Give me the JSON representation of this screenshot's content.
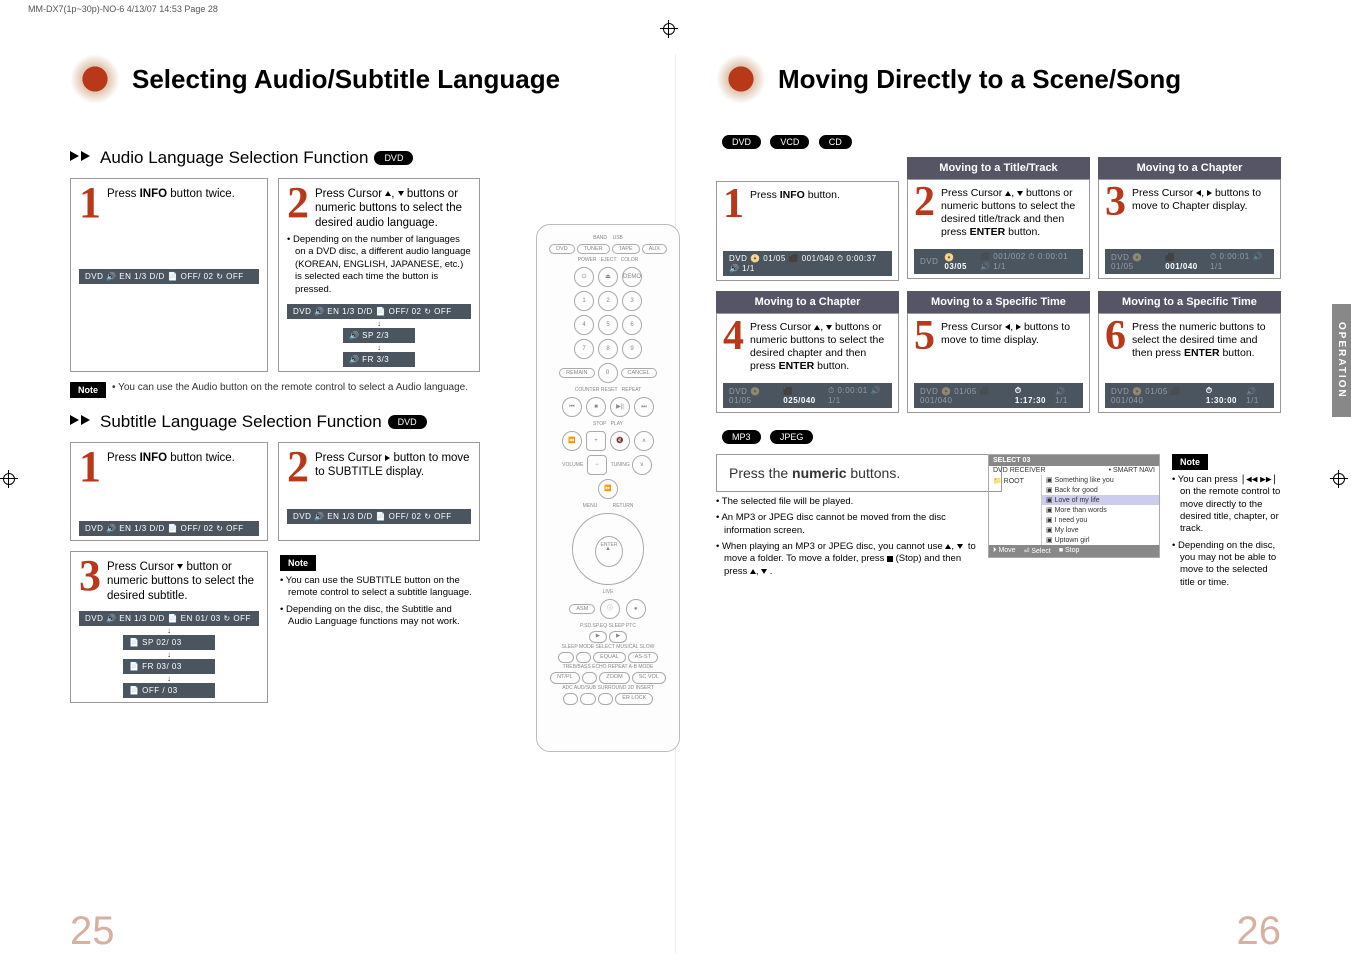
{
  "meta": {
    "header": "MM-DX7(1p~30p)-NO-6  4/13/07  14:53  Page 28"
  },
  "left": {
    "pageNumber": "25",
    "title": "Selecting Audio/Subtitle Language",
    "sectionA": {
      "heading": "Audio Language Selection Function",
      "badge": "DVD",
      "step1": "Press INFO button twice.",
      "step2": "Press Cursor ▲, ▼ buttons or numeric buttons to select the desired audio language.",
      "step2Bullet": "Depending on the number of languages on a DVD disc, a different audio language (KOREAN, ENGLISH, JAPANESE, etc.) is selected each time the button is pressed.",
      "osd1": "DVD  🔊 EN 1/3  D/D  📄 OFF/ 02  ↻ OFF",
      "osd2a": "DVD  🔊 EN 1/3  D/D  📄 OFF/ 02  ↻ OFF",
      "osd2b": "🔊 SP 2/3",
      "osd2c": "🔊 FR 3/3",
      "noteLabel": "Note",
      "note": "You can use the Audio button on the remote control to select a Audio language."
    },
    "sectionB": {
      "heading": "Subtitle Language Selection Function",
      "badge": "DVD",
      "step1": "Press INFO button twice.",
      "step2": "Press Cursor ▶ button to move to SUBTITLE display.",
      "step3": "Press Cursor ▼ button or numeric buttons to select the desired subtitle.",
      "osdA": "DVD  🔊 EN 1/3  D/D  📄 OFF/ 02  ↻ OFF",
      "osdB": "DVD  🔊 EN 1/3  D/D  📄 OFF/ 02  ↻ OFF",
      "osdCrow": "DVD  🔊 EN 1/3  D/D  📄 EN 01/ 03  ↻ OFF",
      "osdC1": "📄 SP 02/ 03",
      "osdC2": "📄 FR 03/ 03",
      "osdC3": "📄 OFF / 03",
      "noteLabel": "Note",
      "note1": "You can use the SUBTITLE button on the remote control to select a subtitle language.",
      "note2": "Depending on the disc, the Subtitle and Audio Language functions may not work."
    },
    "remote": {
      "band": "BAND",
      "usb": "USB",
      "dvd": "DVD",
      "tuner": "TUNER",
      "tape": "TAPE",
      "aux": "AUX",
      "power": "POWER",
      "eject": "EJECT",
      "color": "COLOR",
      "demo": "DEMO",
      "n": [
        "1",
        "2",
        "3",
        "4",
        "5",
        "6",
        "7",
        "8",
        "9",
        "0"
      ],
      "remain": "REMAIN",
      "cancel": "CANCEL",
      "counterreset": "COUNTER RESET",
      "repeat": "REPEAT",
      "stop": "STOP",
      "play": "PLAY",
      "volume": "VOLUME",
      "mute": "MUTE",
      "tuning": "TUNING",
      "menu": "MENU",
      "return": "RETURN",
      "enter": "ENTER",
      "asm": "ASM",
      "live": "LIVE",
      "psdspeq": "P.SD.SP.EQ",
      "sleep": "SLEEP",
      "ptc": "PTC",
      "sleepmode": "SLEEP MODE",
      "select": "SELECT",
      "musical": "MUSICAL",
      "slow": "SLOW",
      "equal": "EQUAL",
      "asst": "AS-ST",
      "trebbass": "TREB/BASS",
      "echo": "ECHO",
      "repeatab": "REPEAT A-B",
      "mode": "MODE",
      "ntpl": "NT/PL",
      "zoom": "ZOOM",
      "scvol": "SC VOL",
      "adc": "ADC",
      "audsub": "AUD/SUB",
      "surround3d": "SURROUND 3D",
      "insert": "INSERT",
      "erlock": "ER LOCK"
    }
  },
  "right": {
    "pageNumber": "26",
    "sideTab": "OPERATION",
    "title": "Moving Directly to a Scene/Song",
    "badges": [
      "DVD",
      "VCD",
      "CD"
    ],
    "row1": {
      "colTitles": [
        "Moving to a Title/Track",
        "Moving to a Chapter"
      ],
      "step1": "Press INFO button.",
      "step2": "Press Cursor ▲, ▼ buttons or numeric buttons to select the desired title/track and then press ENTER button.",
      "step3": "Press Cursor ◀, ▶ buttons to move to Chapter display.",
      "osd1": "DVD  📀 01/05  ⬛ 001/040  ⏱ 0:00:37  🔊 1/1",
      "osd2": "DVD  📀 03/05  ⬛ 001/002  ⏱ 0:00:01  🔊 1/1",
      "osd3": "DVD  📀 01/05  ⬛ 001/040  ⏱ 0:00:01  🔊 1/1"
    },
    "row2": {
      "colTitles": [
        "Moving to a Chapter",
        "Moving to a Specific Time",
        "Moving to a Specific Time"
      ],
      "step4": "Press Cursor ▲, ▼ buttons or numeric buttons to select the desired chapter and then press ENTER button.",
      "step5": "Press Cursor ◀, ▶ buttons to move to time display.",
      "step6": "Press the numeric buttons to select the desired time and then press ENTER button.",
      "osd4": "DVD  📀 01/05  ⬛ 025/040  ⏱ 0:00:01  🔊 1/1",
      "osd5": "DVD  📀 01/05  ⬛ 001/040  ⏱ 1:17:30  🔊 1/1",
      "osd6": "DVD  📀 01/05  ⬛ 001/040  ⏱ 1:30:00  🔊 1/1"
    },
    "mp3": {
      "badges": [
        "MP3",
        "JPEG"
      ],
      "instr": "Press the numeric buttons.",
      "b1": "The selected file will be played.",
      "b2": "An MP3 or JPEG disc cannot be moved from the disc information screen.",
      "b3": "When playing an MP3 or JPEG disc, you cannot use ▲, ▼  to move a folder. To move a folder, press ■ (Stop) and then press ▲, ▼ ."
    },
    "filelist": {
      "head": "SELECT  03",
      "src": "DVD RECEIVER",
      "smart": "• SMART NAVI",
      "root": "ROOT",
      "items": [
        "Something like you",
        "Back for good",
        "Love of my life",
        "More than words",
        "I need you",
        "My love",
        "Uptown girl"
      ],
      "sel_index": 2,
      "foot": [
        "⏵ Move",
        "⏎ Select",
        "■ Stop"
      ]
    },
    "note": {
      "label": "Note",
      "n1": "You can press |◀◀ ▶▶| on the remote control to move directly to the desired title, chapter, or track.",
      "n2": "Depending on the disc, you may not be able to move to the selected title or time."
    }
  }
}
